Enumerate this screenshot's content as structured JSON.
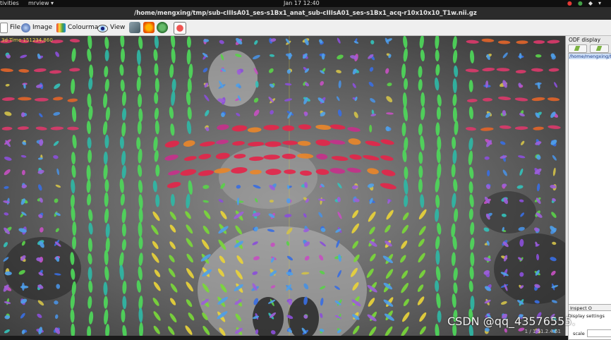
{
  "topbar": {
    "activities": "tivities",
    "app": "mrview ▾",
    "clock": "Jan 17  12:40"
  },
  "window": {
    "title": "/home/mengxing/tmp/sub-cIIIsA01_ses-s1Bx1_anat_sub-cIIIsA01_ses-s1Bx1_acq-r10x10x10_T1w.nii.gz"
  },
  "toolbar": {
    "file": "File",
    "image": "Image",
    "colourmap": "Colourmap",
    "view": "View"
  },
  "viewport": {
    "label": "3d Time 151234,860",
    "status": "1 / 1  51.2.4.61"
  },
  "odf_panel": {
    "title": "ODF display",
    "list_item": "/home/mengxing/tmp/",
    "inspect": "Inspect O",
    "display_settings": "Display settings",
    "scale_label": "scale"
  },
  "watermark": "CSDN @qq_43576555.",
  "colors": {
    "accent": "#e8d24a",
    "titlebar": "#2b2b2b",
    "toolbar": "#efefef"
  }
}
